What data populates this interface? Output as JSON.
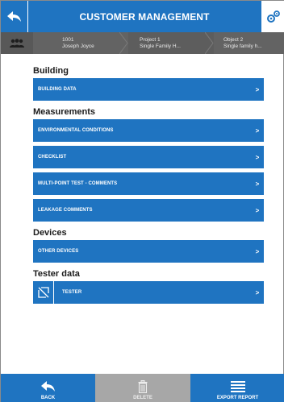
{
  "header": {
    "title": "CUSTOMER MANAGEMENT"
  },
  "breadcrumb": {
    "customer": {
      "id": "1001",
      "name": "Joseph Joyce"
    },
    "project": {
      "name": "Project 1",
      "type": "Single Family H..."
    },
    "object": {
      "name": "Object 2",
      "type": "Single family h..."
    }
  },
  "sections": {
    "building": {
      "heading": "Building",
      "items": [
        {
          "label": "BUILDING DATA"
        }
      ]
    },
    "measurements": {
      "heading": "Measurements",
      "items": [
        {
          "label": "ENVIRONMENTAL CONDITIONS"
        },
        {
          "label": "CHECKLIST"
        },
        {
          "label": "MULTI-POINT TEST - COMMENTS"
        },
        {
          "label": "LEAKAGE COMMENTS"
        }
      ]
    },
    "devices": {
      "heading": "Devices",
      "items": [
        {
          "label": "OTHER DEVICES"
        }
      ]
    },
    "tester": {
      "heading": "Tester data",
      "items": [
        {
          "label": "TESTER"
        }
      ]
    }
  },
  "chevron": ">",
  "bottom": {
    "back_label": "BACK",
    "delete_label": "DELETE",
    "export_label": "EXPORT REPORT"
  },
  "colors": {
    "accent": "#1f74c1",
    "breadcrumb_bg": "#5f5f5f",
    "disabled": "#a7a7a7"
  },
  "icons": {
    "back": "back-arrow-icon",
    "settings": "gears-icon",
    "customer": "people-icon",
    "tester": "edit-icon",
    "delete": "trash-icon",
    "export": "menu-lines-icon"
  }
}
